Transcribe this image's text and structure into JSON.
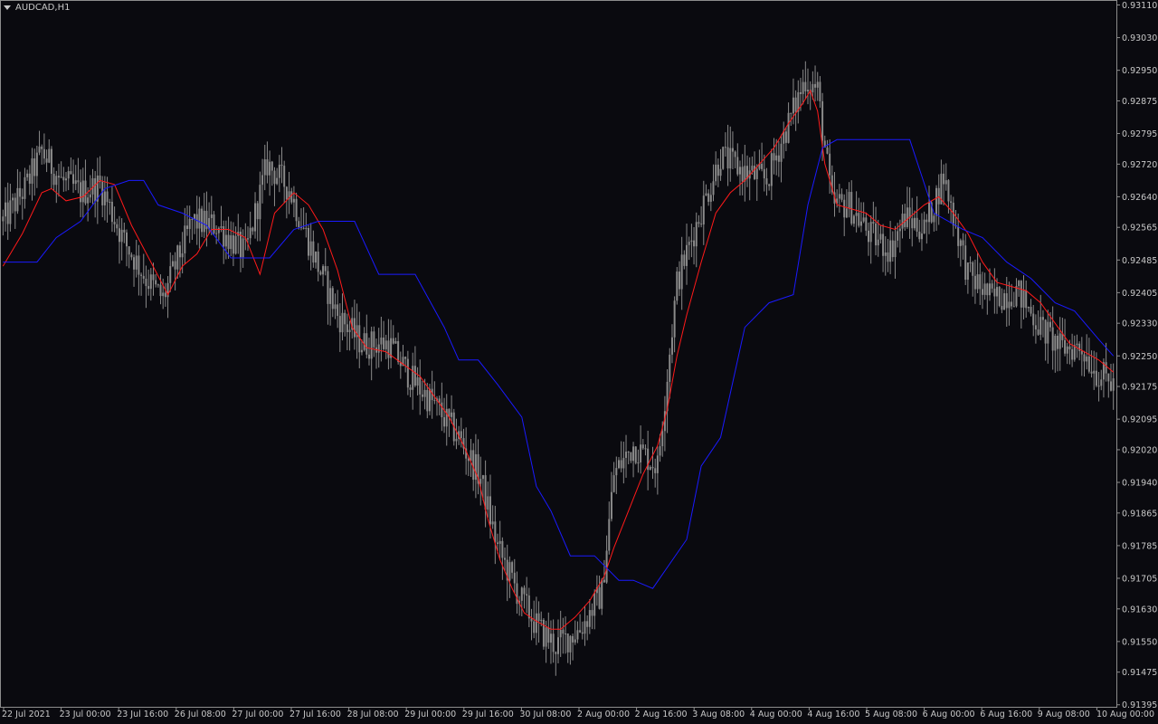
{
  "window": {
    "symbol_label": "AUDCAD,H1"
  },
  "colors": {
    "background": "#0a0a0f",
    "frame": "#8c8c8c",
    "candle": "#8a8a8a",
    "text": "#c8c8c8",
    "red_line": "#ff1a1a",
    "blue_line": "#1a1aff"
  },
  "chart_data": {
    "type": "candlestick",
    "symbol": "AUDCAD",
    "timeframe": "H1",
    "ylim": [
      0.9139,
      0.9312
    ],
    "grid": false,
    "y_ticks": [
      "0.93110",
      "0.93030",
      "0.92950",
      "0.92875",
      "0.92795",
      "0.92720",
      "0.92640",
      "0.92565",
      "0.92485",
      "0.92405",
      "0.92330",
      "0.92250",
      "0.92175",
      "0.92095",
      "0.92020",
      "0.91940",
      "0.91865",
      "0.91785",
      "0.91705",
      "0.91630",
      "0.91550",
      "0.91475",
      "0.91395"
    ],
    "x_ticks": [
      "22 Jul 2021",
      "23 Jul 00:00",
      "23 Jul 16:00",
      "26 Jul 08:00",
      "27 Jul 00:00",
      "27 Jul 16:00",
      "28 Jul 08:00",
      "29 Jul 00:00",
      "29 Jul 16:00",
      "30 Jul 08:00",
      "2 Aug 00:00",
      "2 Aug 16:00",
      "3 Aug 08:00",
      "4 Aug 00:00",
      "4 Aug 16:00",
      "5 Aug 08:00",
      "6 Aug 00:00",
      "6 Aug 16:00",
      "9 Aug 08:00",
      "10 Aug 00:00"
    ],
    "price_path": [
      [
        0,
        0.9258
      ],
      [
        9,
        0.9266
      ],
      [
        16,
        0.9275
      ],
      [
        24,
        0.9268
      ],
      [
        32,
        0.9265
      ],
      [
        40,
        0.9267
      ],
      [
        50,
        0.9253
      ],
      [
        59,
        0.9244
      ],
      [
        66,
        0.9239
      ],
      [
        78,
        0.9258
      ],
      [
        88,
        0.9257
      ],
      [
        100,
        0.925
      ],
      [
        109,
        0.9272
      ],
      [
        118,
        0.9266
      ],
      [
        128,
        0.925
      ],
      [
        138,
        0.9235
      ],
      [
        148,
        0.9228
      ],
      [
        159,
        0.9228
      ],
      [
        169,
        0.9219
      ],
      [
        178,
        0.9213
      ],
      [
        188,
        0.9205
      ],
      [
        197,
        0.9195
      ],
      [
        204,
        0.9178
      ],
      [
        213,
        0.9166
      ],
      [
        221,
        0.9158
      ],
      [
        228,
        0.9154
      ],
      [
        238,
        0.9158
      ],
      [
        247,
        0.9167
      ],
      [
        252,
        0.9196
      ],
      [
        260,
        0.9203
      ],
      [
        270,
        0.9198
      ],
      [
        278,
        0.9243
      ],
      [
        287,
        0.9259
      ],
      [
        296,
        0.9274
      ],
      [
        306,
        0.927
      ],
      [
        315,
        0.9268
      ],
      [
        322,
        0.9279
      ],
      [
        331,
        0.9293
      ],
      [
        336,
        0.929
      ],
      [
        342,
        0.9262
      ],
      [
        349,
        0.9262
      ],
      [
        357,
        0.9255
      ],
      [
        366,
        0.9251
      ],
      [
        372,
        0.9259
      ],
      [
        380,
        0.9256
      ],
      [
        388,
        0.9269
      ],
      [
        398,
        0.9245
      ],
      [
        408,
        0.9239
      ],
      [
        418,
        0.9241
      ],
      [
        428,
        0.9232
      ],
      [
        436,
        0.9227
      ],
      [
        445,
        0.9227
      ],
      [
        451,
        0.9221
      ],
      [
        458,
        0.9218
      ]
    ],
    "series": [
      {
        "name": "",
        "color": "#ff1a1a",
        "points": [
          [
            0,
            0.9247
          ],
          [
            8,
            0.9255
          ],
          [
            16,
            0.9265
          ],
          [
            20,
            0.9266
          ],
          [
            26,
            0.9263
          ],
          [
            33,
            0.9264
          ],
          [
            40,
            0.9268
          ],
          [
            46,
            0.9267
          ],
          [
            53,
            0.9257
          ],
          [
            61,
            0.9248
          ],
          [
            68,
            0.924
          ],
          [
            74,
            0.9247
          ],
          [
            80,
            0.925
          ],
          [
            86,
            0.9256
          ],
          [
            93,
            0.9256
          ],
          [
            100,
            0.9254
          ],
          [
            106,
            0.9245
          ],
          [
            112,
            0.926
          ],
          [
            120,
            0.9265
          ],
          [
            126,
            0.9262
          ],
          [
            132,
            0.9256
          ],
          [
            138,
            0.9246
          ],
          [
            144,
            0.9232
          ],
          [
            150,
            0.9227
          ],
          [
            158,
            0.9226
          ],
          [
            165,
            0.9223
          ],
          [
            172,
            0.922
          ],
          [
            178,
            0.9215
          ],
          [
            184,
            0.921
          ],
          [
            190,
            0.9203
          ],
          [
            196,
            0.9195
          ],
          [
            200,
            0.9185
          ],
          [
            205,
            0.9175
          ],
          [
            210,
            0.9168
          ],
          [
            215,
            0.9162
          ],
          [
            220,
            0.916
          ],
          [
            226,
            0.9158
          ],
          [
            230,
            0.9158
          ],
          [
            236,
            0.9161
          ],
          [
            242,
            0.9165
          ],
          [
            248,
            0.9171
          ],
          [
            252,
            0.9178
          ],
          [
            258,
            0.9187
          ],
          [
            264,
            0.9196
          ],
          [
            270,
            0.9203
          ],
          [
            274,
            0.9212
          ],
          [
            278,
            0.9225
          ],
          [
            282,
            0.9235
          ],
          [
            288,
            0.9248
          ],
          [
            294,
            0.926
          ],
          [
            300,
            0.9265
          ],
          [
            306,
            0.9268
          ],
          [
            312,
            0.9272
          ],
          [
            318,
            0.9276
          ],
          [
            324,
            0.9282
          ],
          [
            330,
            0.9287
          ],
          [
            333,
            0.929
          ],
          [
            336,
            0.9285
          ],
          [
            339,
            0.9272
          ],
          [
            344,
            0.9262
          ],
          [
            350,
            0.9261
          ],
          [
            356,
            0.926
          ],
          [
            362,
            0.9257
          ],
          [
            368,
            0.9256
          ],
          [
            374,
            0.9259
          ],
          [
            380,
            0.9262
          ],
          [
            386,
            0.9264
          ],
          [
            392,
            0.926
          ],
          [
            398,
            0.9255
          ],
          [
            404,
            0.9248
          ],
          [
            410,
            0.9243
          ],
          [
            416,
            0.9242
          ],
          [
            422,
            0.9241
          ],
          [
            428,
            0.9238
          ],
          [
            434,
            0.9233
          ],
          [
            440,
            0.9228
          ],
          [
            446,
            0.9226
          ],
          [
            452,
            0.9224
          ],
          [
            458,
            0.9221
          ]
        ]
      },
      {
        "name": "",
        "color": "#1a1aff",
        "points": [
          [
            0,
            0.9248
          ],
          [
            14,
            0.9248
          ],
          [
            22,
            0.9254
          ],
          [
            32,
            0.9258
          ],
          [
            42,
            0.9266
          ],
          [
            52,
            0.9268
          ],
          [
            58,
            0.9268
          ],
          [
            64,
            0.9262
          ],
          [
            74,
            0.926
          ],
          [
            84,
            0.9257
          ],
          [
            94,
            0.9249
          ],
          [
            110,
            0.9249
          ],
          [
            120,
            0.9256
          ],
          [
            130,
            0.9258
          ],
          [
            145,
            0.9258
          ],
          [
            155,
            0.9245
          ],
          [
            170,
            0.9245
          ],
          [
            182,
            0.9232
          ],
          [
            188,
            0.9224
          ],
          [
            196,
            0.9224
          ],
          [
            204,
            0.9218
          ],
          [
            214,
            0.921
          ],
          [
            220,
            0.9193
          ],
          [
            226,
            0.9187
          ],
          [
            234,
            0.9176
          ],
          [
            244,
            0.9176
          ],
          [
            254,
            0.917
          ],
          [
            260,
            0.917
          ],
          [
            268,
            0.9168
          ],
          [
            282,
            0.918
          ],
          [
            288,
            0.9198
          ],
          [
            296,
            0.9205
          ],
          [
            306,
            0.9232
          ],
          [
            316,
            0.9238
          ],
          [
            326,
            0.924
          ],
          [
            332,
            0.9262
          ],
          [
            338,
            0.9276
          ],
          [
            344,
            0.9278
          ],
          [
            352,
            0.9278
          ],
          [
            366,
            0.9278
          ],
          [
            374,
            0.9278
          ],
          [
            384,
            0.926
          ],
          [
            396,
            0.9256
          ],
          [
            404,
            0.9254
          ],
          [
            414,
            0.9248
          ],
          [
            424,
            0.9244
          ],
          [
            434,
            0.9238
          ],
          [
            442,
            0.9236
          ],
          [
            452,
            0.9229
          ],
          [
            458,
            0.9225
          ]
        ]
      }
    ],
    "legend": "none"
  }
}
